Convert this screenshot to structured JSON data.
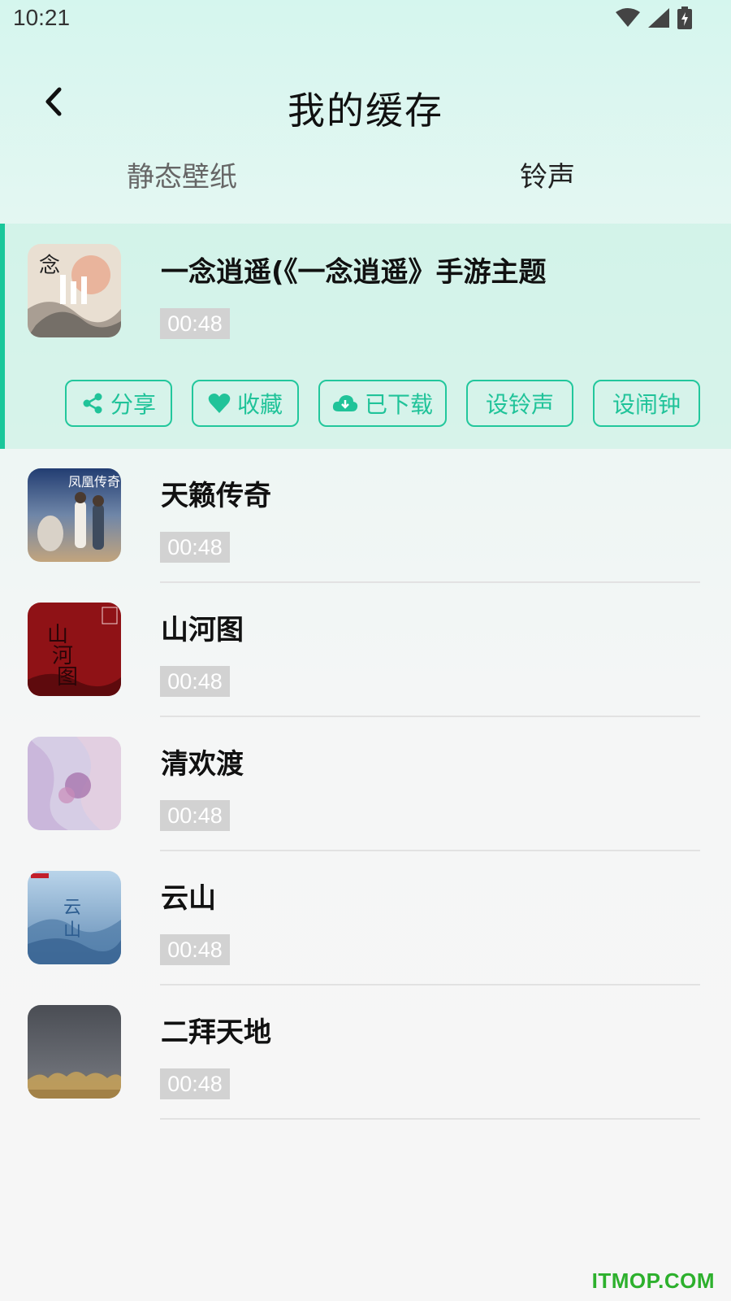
{
  "status_bar": {
    "time": "10:21"
  },
  "header": {
    "title": "我的缓存"
  },
  "tabs": [
    {
      "label": "静态壁纸"
    },
    {
      "label": "铃声"
    }
  ],
  "songs": [
    {
      "title": "一念逍遥(《一念逍遥》手游主题",
      "duration": "00:48"
    },
    {
      "title": "天籁传奇",
      "duration": "00:48"
    },
    {
      "title": "山河图",
      "duration": "00:48"
    },
    {
      "title": "清欢渡",
      "duration": "00:48"
    },
    {
      "title": "云山",
      "duration": "00:48"
    },
    {
      "title": "二拜天地",
      "duration": "00:48"
    }
  ],
  "actions": [
    {
      "label": "分享",
      "icon": "share-icon"
    },
    {
      "label": "收藏",
      "icon": "heart-icon"
    },
    {
      "label": "已下载",
      "icon": "cloud-download-icon"
    },
    {
      "label": "设铃声",
      "icon": ""
    },
    {
      "label": "设闹钟",
      "icon": ""
    }
  ],
  "watermark": "ITMOP.COM",
  "colors": {
    "accent": "#19c79a",
    "duration_bg": "#d2d2d2"
  }
}
